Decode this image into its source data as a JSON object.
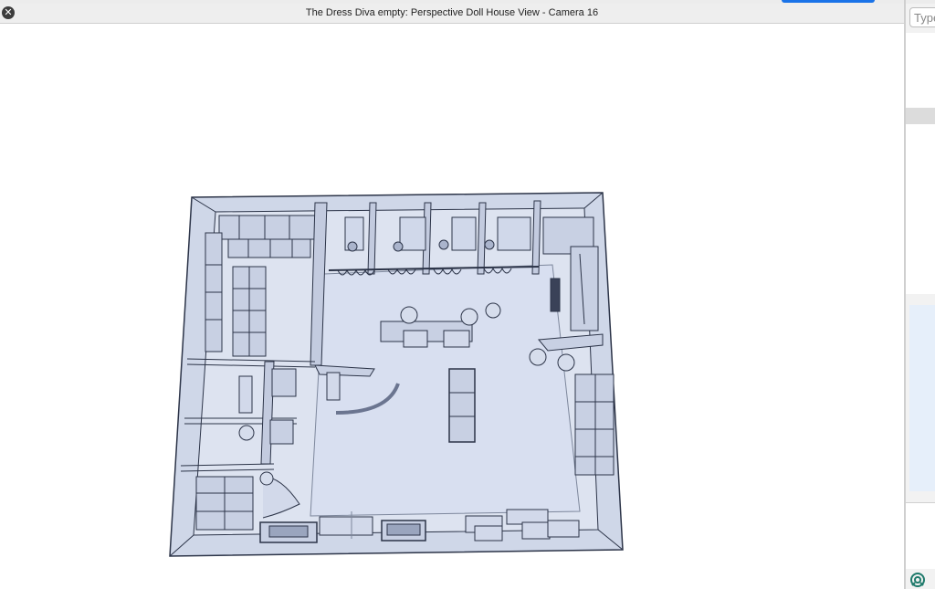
{
  "window": {
    "title": "The Dress Diva empty: Perspective Doll House View - Camera 16"
  },
  "right_panel": {
    "search_placeholder": "Type"
  },
  "colors": {
    "accent": "#1a73e8",
    "model_fill": "#dde3f0",
    "model_stroke": "#2c3448"
  },
  "icons": {
    "close": "close-icon",
    "help": "help-lifebuoy-icon"
  }
}
